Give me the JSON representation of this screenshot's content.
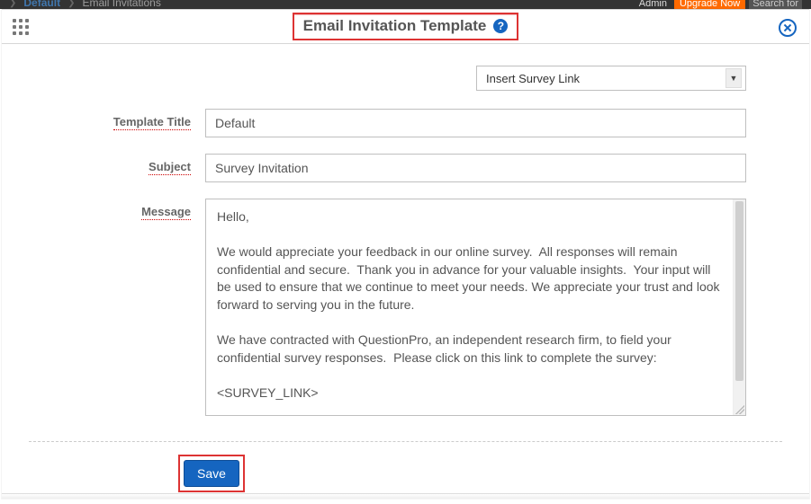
{
  "topbar": {
    "crumb1": "Default",
    "crumb2": "Email Invitations",
    "admin": "Admin",
    "upgrade": "Upgrade Now",
    "search": "Search for"
  },
  "modal": {
    "title": "Email Invitation Template",
    "insert_link_label": "Insert Survey Link"
  },
  "form": {
    "template_title_label": "Template Title",
    "template_title_value": "Default",
    "subject_label": "Subject",
    "subject_value": "Survey Invitation",
    "message_label": "Message",
    "message_value": "Hello,\n\nWe would appreciate your feedback in our online survey.  All responses will remain confidential and secure.  Thank you in advance for your valuable insights.  Your input will be used to ensure that we continue to meet your needs. We appreciate your trust and look forward to serving you in the future.\n\nWe have contracted with QuestionPro, an independent research firm, to field your confidential survey responses.  Please click on this link to complete the survey:\n\n<SURVEY_LINK>"
  },
  "actions": {
    "save_label": "Save"
  }
}
